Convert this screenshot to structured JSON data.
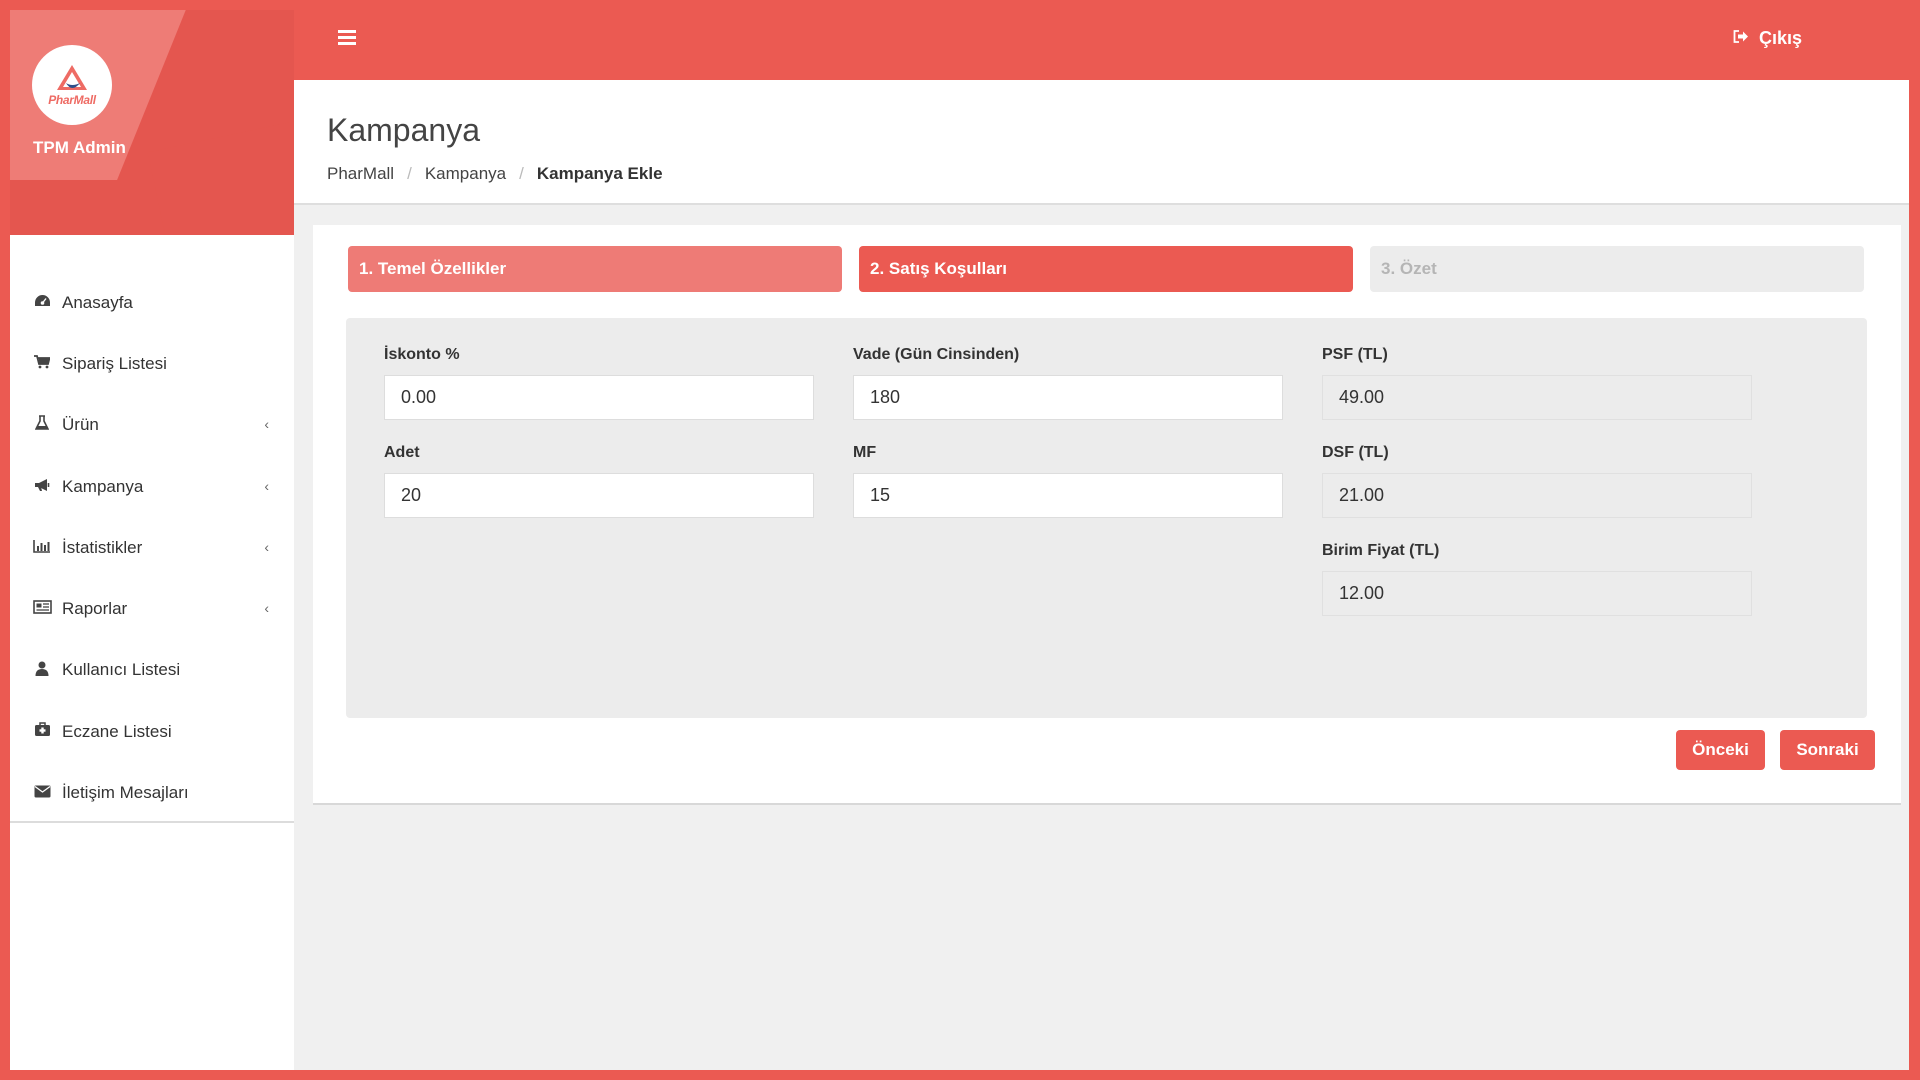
{
  "brand": {
    "logo_text": "PharMall",
    "name": "TPM Admin"
  },
  "sidebar": {
    "items": [
      {
        "label": "Anasayfa",
        "icon": "dashboard-icon",
        "has_submenu": false
      },
      {
        "label": "Sipariş Listesi",
        "icon": "cart-icon",
        "has_submenu": false
      },
      {
        "label": "Ürün",
        "icon": "flask-icon",
        "has_submenu": true
      },
      {
        "label": "Kampanya",
        "icon": "megaphone-icon",
        "has_submenu": true
      },
      {
        "label": "İstatistikler",
        "icon": "bar-chart-icon",
        "has_submenu": true
      },
      {
        "label": "Raporlar",
        "icon": "newspaper-icon",
        "has_submenu": true
      },
      {
        "label": "Kullanıcı Listesi",
        "icon": "user-icon",
        "has_submenu": false
      },
      {
        "label": "Eczane Listesi",
        "icon": "medkit-icon",
        "has_submenu": false
      },
      {
        "label": "İletişim Mesajları",
        "icon": "envelope-icon",
        "has_submenu": false
      }
    ]
  },
  "topbar": {
    "logout_label": "Çıkış"
  },
  "header": {
    "title": "Kampanya",
    "breadcrumb": [
      "PharMall",
      "Kampanya",
      "Kampanya Ekle"
    ]
  },
  "wizard": {
    "steps": [
      {
        "label": "1. Temel Özellikler",
        "state": "done"
      },
      {
        "label": "2. Satış Koşulları",
        "state": "current"
      },
      {
        "label": "3. Özet",
        "state": "todo"
      }
    ]
  },
  "form": {
    "iskonto": {
      "label": "İskonto %",
      "value": "0.00"
    },
    "vade": {
      "label": "Vade (Gün Cinsinden)",
      "value": "180"
    },
    "psf": {
      "label": "PSF (TL)",
      "value": "49.00"
    },
    "adet": {
      "label": "Adet",
      "value": "20"
    },
    "mf": {
      "label": "MF",
      "value": "15"
    },
    "dsf": {
      "label": "DSF (TL)",
      "value": "21.00"
    },
    "birim_fiyat": {
      "label": "Birim Fiyat (TL)",
      "value": "12.00"
    }
  },
  "actions": {
    "prev_label": "Önceki",
    "next_label": "Sonraki"
  },
  "colors": {
    "accent": "#eb5a52",
    "accent_light": "#ee7b76",
    "panel": "#ececec"
  }
}
